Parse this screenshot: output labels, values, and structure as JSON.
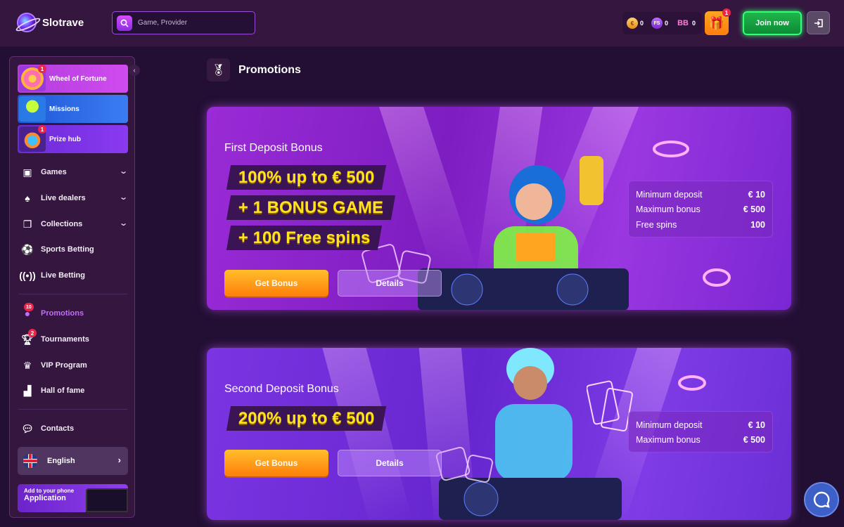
{
  "header": {
    "brand": "Slotrave",
    "search_placeholder": "Game, Provider",
    "wallet": [
      {
        "icon": "coin-icon",
        "value": "0"
      },
      {
        "icon": "free-spins-icon",
        "label": "FS",
        "value": "0"
      },
      {
        "icon": "bonus-balance-icon",
        "label": "BB",
        "value": "0"
      }
    ],
    "gift_badge": "1",
    "join_label": "Join now"
  },
  "sidebar": {
    "promo_cards": [
      {
        "label": "Wheel of Fortune",
        "badge": "1"
      },
      {
        "label": "Missions"
      },
      {
        "label": "Prize hub",
        "badge": "1"
      }
    ],
    "nav": [
      {
        "label": "Games",
        "icon": "games-icon"
      },
      {
        "label": "Live dealers",
        "icon": "live-dealers-icon"
      },
      {
        "label": "Collections",
        "icon": "collections-icon"
      },
      {
        "label": "Sports Betting",
        "icon": "soccer-ball-icon"
      },
      {
        "label": "Live Betting",
        "icon": "broadcast-icon"
      }
    ],
    "nav2": [
      {
        "label": "Promotions",
        "icon": "promotions-icon",
        "badge": "10"
      },
      {
        "label": "Tournaments",
        "icon": "trophy-icon",
        "badge": "2"
      },
      {
        "label": "VIP Program",
        "icon": "crown-icon"
      },
      {
        "label": "Hall of fame",
        "icon": "podium-icon"
      }
    ],
    "contacts": "Contacts",
    "language": "English",
    "app_banner": {
      "line1": "Add to your phone",
      "line2": "Application"
    }
  },
  "main": {
    "title": "Promotions",
    "banners": [
      {
        "name": "First Deposit Bonus",
        "offers": [
          "100% up to € 500",
          "+ 1 BONUS GAME",
          "+ 100 Free spins"
        ],
        "get_bonus": "Get Bonus",
        "details": "Details",
        "stats": [
          {
            "label": "Minimum deposit",
            "value": "€ 10"
          },
          {
            "label": "Maximum bonus",
            "value": "€ 500"
          },
          {
            "label": "Free spins",
            "value": "100"
          }
        ]
      },
      {
        "name": "Second Deposit Bonus",
        "offers": [
          "200% up to € 500"
        ],
        "get_bonus": "Get Bonus",
        "details": "Details",
        "stats": [
          {
            "label": "Minimum deposit",
            "value": "€ 10"
          },
          {
            "label": "Maximum bonus",
            "value": "€ 500"
          }
        ]
      }
    ]
  },
  "colors": {
    "accent_purple": "#9b4cd9",
    "join_green": "#1fb64b",
    "offer_yellow": "#ffe31b",
    "bonus_orange": "#ff9a1a"
  }
}
